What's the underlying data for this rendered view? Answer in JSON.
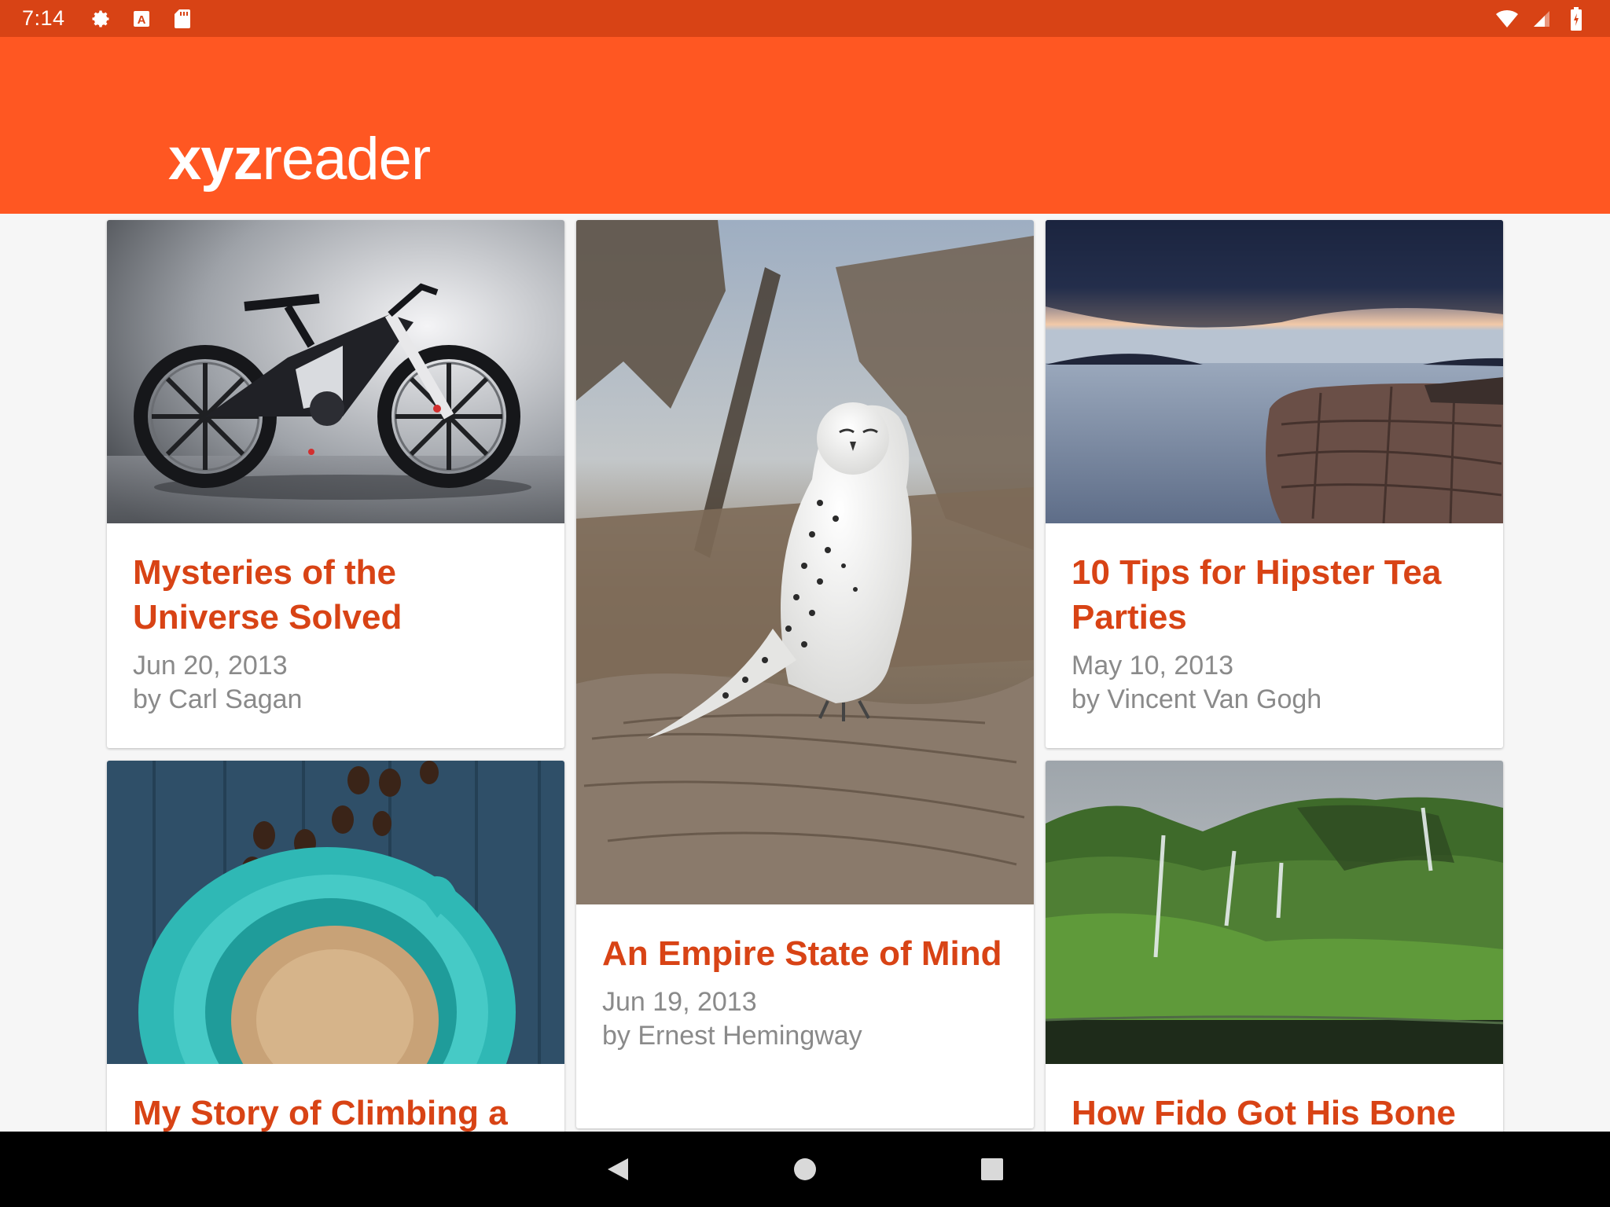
{
  "status_bar": {
    "time": "7:14",
    "left_icons": [
      "gear-icon",
      "keyboard-a-icon",
      "sd-card-icon"
    ],
    "right_icons": [
      "wifi-icon",
      "signal-icon",
      "battery-icon"
    ]
  },
  "app_bar": {
    "logo_bold": "xyz",
    "logo_regular": "reader",
    "color": "#ff5722",
    "status_color": "#d84315"
  },
  "articles": [
    {
      "title": "Mysteries of the Universe Solved",
      "date": "Jun 20, 2013",
      "author": "by Carl Sagan",
      "image": "bicycle-photo"
    },
    {
      "title": "An Empire State of Mind",
      "date": "Jun 19, 2013",
      "author": "by Ernest Hemingway",
      "image": "snowy-owl-photo"
    },
    {
      "title": "10 Tips for Hipster Tea Parties",
      "date": "May 10, 2013",
      "author": "by Vincent Van Gogh",
      "image": "coastline-sunset-photo"
    },
    {
      "title": "My Story of Climbing a",
      "image": "coffee-cup-photo"
    },
    {
      "title": "How Fido Got His Bone",
      "image": "green-cliffs-waterfall-photo"
    }
  ],
  "title_color": "#d84315",
  "meta_color": "#8a8a8a",
  "nav_bar": {
    "buttons": [
      "back-icon",
      "home-icon",
      "recents-icon"
    ]
  }
}
